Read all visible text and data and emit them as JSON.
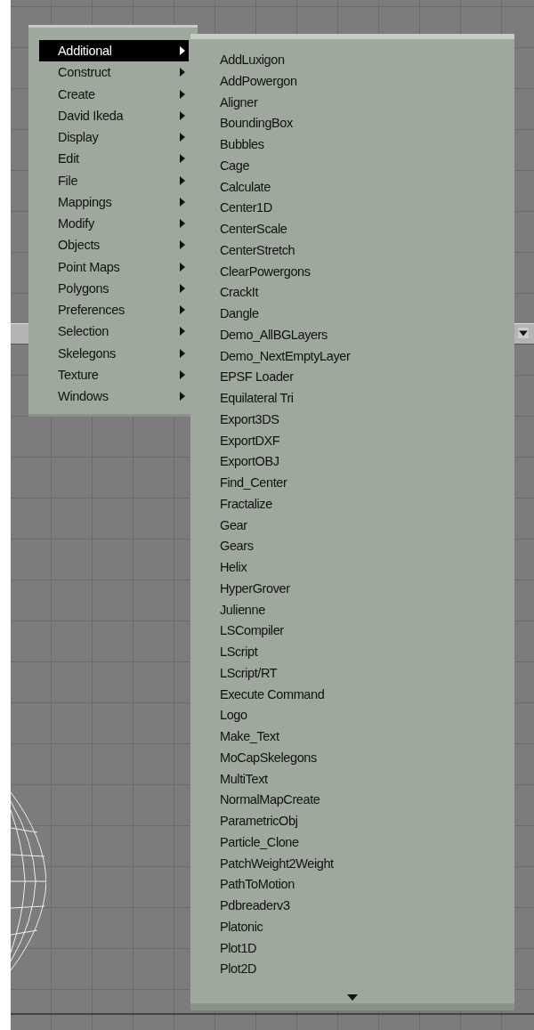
{
  "menu": {
    "items": [
      {
        "label": "Additional",
        "selected": true
      },
      {
        "label": "Construct",
        "selected": false
      },
      {
        "label": "Create",
        "selected": false
      },
      {
        "label": "David Ikeda",
        "selected": false
      },
      {
        "label": "Display",
        "selected": false
      },
      {
        "label": "Edit",
        "selected": false
      },
      {
        "label": "File",
        "selected": false
      },
      {
        "label": "Mappings",
        "selected": false
      },
      {
        "label": "Modify",
        "selected": false
      },
      {
        "label": "Objects",
        "selected": false
      },
      {
        "label": "Point Maps",
        "selected": false
      },
      {
        "label": "Polygons",
        "selected": false
      },
      {
        "label": "Preferences",
        "selected": false
      },
      {
        "label": "Selection",
        "selected": false
      },
      {
        "label": "Skelegons",
        "selected": false
      },
      {
        "label": "Texture",
        "selected": false
      },
      {
        "label": "Windows",
        "selected": false
      }
    ]
  },
  "submenu": {
    "items": [
      "AddLuxigon",
      "AddPowergon",
      "Aligner",
      "BoundingBox",
      "Bubbles",
      "Cage",
      "Calculate",
      "Center1D",
      "CenterScale",
      "CenterStretch",
      "ClearPowergons",
      "CrackIt",
      "Dangle",
      "Demo_AllBGLayers",
      "Demo_NextEmptyLayer",
      "EPSF Loader",
      "Equilateral Tri",
      "Export3DS",
      "ExportDXF",
      "ExportOBJ",
      "Find_Center",
      "Fractalize",
      "Gear",
      "Gears",
      "Helix",
      "HyperGrover",
      "Julienne",
      "LSCompiler",
      "LScript",
      "LScript/RT",
      "Execute Command",
      "Logo",
      "Make_Text",
      "MoCapSkelegons",
      "MultiText",
      "NormalMapCreate",
      "ParametricObj",
      "Particle_Clone",
      "PatchWeight2Weight",
      "PathToMotion",
      "Pdbreaderv3",
      "Platonic",
      "Plot1D",
      "Plot2D"
    ]
  }
}
